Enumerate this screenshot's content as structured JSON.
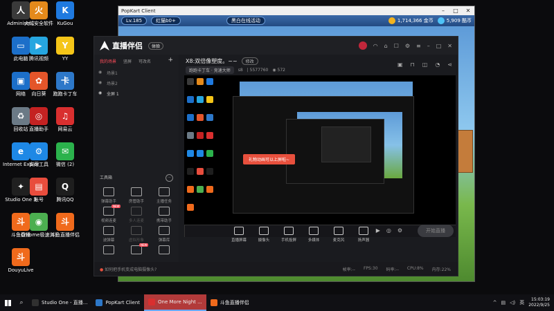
{
  "desktop": {
    "icons": [
      {
        "label": "5577760\nAdministr...",
        "color": "#3a3a3a",
        "glyph": "人"
      },
      {
        "label": "火绒安全软件",
        "color": "#e48a1b",
        "glyph": "火"
      },
      {
        "label": "KuGou",
        "color": "#1f7ae0",
        "glyph": "K"
      },
      {
        "label": "此电脑",
        "color": "#1c6fc9",
        "glyph": "▭"
      },
      {
        "label": "腾讯视频",
        "color": "#26a6e0",
        "glyph": "▶"
      },
      {
        "label": "YY",
        "color": "#f5c518",
        "glyph": "Y"
      },
      {
        "label": "网络",
        "color": "#1c6fc9",
        "glyph": "▣"
      },
      {
        "label": "向日葵",
        "color": "#e4552a",
        "glyph": "✿"
      },
      {
        "label": "跑跑卡丁车",
        "color": "#2d78c9",
        "glyph": "卡"
      },
      {
        "label": "回收站",
        "color": "#6b7a86",
        "glyph": "♻"
      },
      {
        "label": "直播助手",
        "color": "#c42222",
        "glyph": "◎"
      },
      {
        "label": "网易云",
        "color": "#d92f2f",
        "glyph": "♫"
      },
      {
        "label": "Internet Explorer",
        "color": "#1e88e5",
        "glyph": "e"
      },
      {
        "label": "实用工具",
        "color": "#1e88e5",
        "glyph": "⚙"
      },
      {
        "label": "微信 (2)",
        "color": "#2bb24c",
        "glyph": "✉"
      },
      {
        "label": "Studio One 3",
        "color": "#202020",
        "glyph": "✦"
      },
      {
        "label": "账号",
        "color": "#e84d3d",
        "glyph": "▤"
      },
      {
        "label": "腾讯QQ",
        "color": "#1e1e1e",
        "glyph": "Q"
      },
      {
        "label": "斗鱼直播",
        "color": "#f06a1c",
        "glyph": "斗"
      },
      {
        "label": "Chrome极速浏览器",
        "color": "#4caf50",
        "glyph": "◉"
      },
      {
        "label": "斗鱼直播伴侣",
        "color": "#f06a1c",
        "glyph": "斗"
      },
      {
        "label": "DouyuLive",
        "color": "#f06a1c",
        "glyph": "斗"
      }
    ]
  },
  "popkart": {
    "title": "PopKart Client",
    "level": "Lv.185",
    "player": "红猫b0+",
    "server": "黑白在线活动",
    "coins": "1,714,366 金币",
    "points": "5,909 酷币"
  },
  "app": {
    "name": "直播伴侣",
    "version": "体验",
    "tabs": [
      "我的场景",
      "竖屏",
      "可改名"
    ],
    "scenes": [
      "场景1",
      "场景2",
      "全屏 1"
    ],
    "tools_title": "工具箱",
    "tools": [
      {
        "label": "弹幕助手",
        "dim": false,
        "new": false
      },
      {
        "label": "房管助手",
        "dim": false,
        "new": false
      },
      {
        "label": "主播任务",
        "dim": false,
        "new": false
      },
      {
        "label": "视频连麦",
        "dim": false,
        "new": true
      },
      {
        "label": "多人连麦",
        "dim": true,
        "new": false
      },
      {
        "label": "携带助手",
        "dim": false,
        "new": false
      },
      {
        "label": "波弹幕",
        "dim": false,
        "new": false
      },
      {
        "label": "虚拟形象",
        "dim": true,
        "new": false
      },
      {
        "label": "弹幕库",
        "dim": false,
        "new": false
      },
      {
        "label": "",
        "dim": false,
        "new": false
      },
      {
        "label": "",
        "dim": false,
        "new": true
      },
      {
        "label": "",
        "dim": false,
        "new": false
      }
    ],
    "room": {
      "title": "X8:双倍像塑度。~~",
      "edit_label": "修改",
      "category": "跑跑卡丁车 · 竞速大师",
      "room_id": "5577760",
      "viewers": "572",
      "level": "s8"
    },
    "toast": "礼物动画可以上屏啦~",
    "bottom": [
      "直播屏幕",
      "摄像头",
      "手机投屏",
      "多媒体",
      "麦克风",
      "扬声器"
    ],
    "go_live": "开始直播",
    "tip": "如何把手机变成电脑摄像头?",
    "stats": [
      "帧率:--",
      "FPS:30",
      "码率:--",
      "CPU:8%",
      "内存:22%"
    ]
  },
  "taskbar": {
    "apps": [
      {
        "label": "Studio One - 直播...",
        "color": "#303030",
        "active": false
      },
      {
        "label": "PopKart Client",
        "color": "#2d78c9",
        "active": false
      },
      {
        "label": "One More Night ...",
        "color": "#d92f2f",
        "active": true
      },
      {
        "label": "斗鱼直播伴侣",
        "color": "#f06a1c",
        "active": false
      }
    ],
    "time": "15:03:19",
    "date": "2022/9/25",
    "lang": "英"
  },
  "colors": {
    "accent": "#ff4d5a",
    "toast": "#e8503d"
  }
}
